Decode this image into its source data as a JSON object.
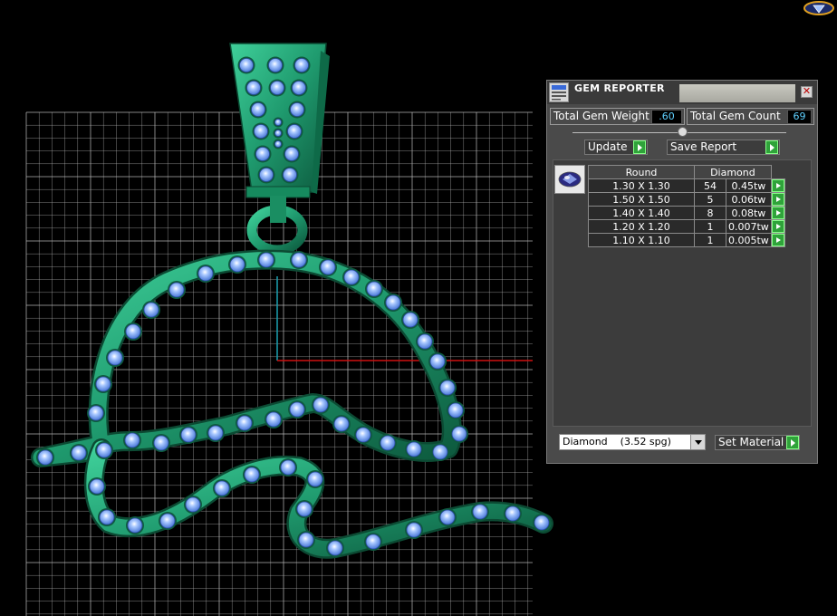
{
  "gem_reporter": {
    "title": "GEM REPORTER",
    "close_glyph": "✕",
    "total_gem_weight_label": "Total Gem Weight",
    "total_gem_weight_value": ".60",
    "total_gem_count_label": "Total Gem Count",
    "total_gem_count_value": "69",
    "update_label": "Update",
    "save_report_label": "Save Report",
    "table": {
      "headers": [
        "Round",
        "Diamond"
      ],
      "rows": [
        {
          "size": "1.30 X 1.30",
          "count": "54",
          "weight": "0.45tw"
        },
        {
          "size": "1.50 X 1.50",
          "count": "5",
          "weight": "0.06tw"
        },
        {
          "size": "1.40 X 1.40",
          "count": "8",
          "weight": "0.08tw"
        },
        {
          "size": "1.20 X 1.20",
          "count": "1",
          "weight": "0.007tw"
        },
        {
          "size": "1.10 X 1.10",
          "count": "1",
          "weight": "0.005tw"
        }
      ]
    },
    "material_select_value": "Diamond    (3.52 spg)",
    "set_material_label": "Set Material"
  },
  "viewport": {
    "metal_color": "#1f9a6e",
    "gem_color": "#8fb8ff",
    "grid_color": "#bdbdbd",
    "axis_x_color": "#d01010",
    "axis_y_color": "#1aa0b0"
  },
  "icons": [
    "app-logo-icon",
    "gem-reporter-icon",
    "close-icon",
    "play-icon",
    "round-gem-icon",
    "dropdown-arrow-icon"
  ]
}
